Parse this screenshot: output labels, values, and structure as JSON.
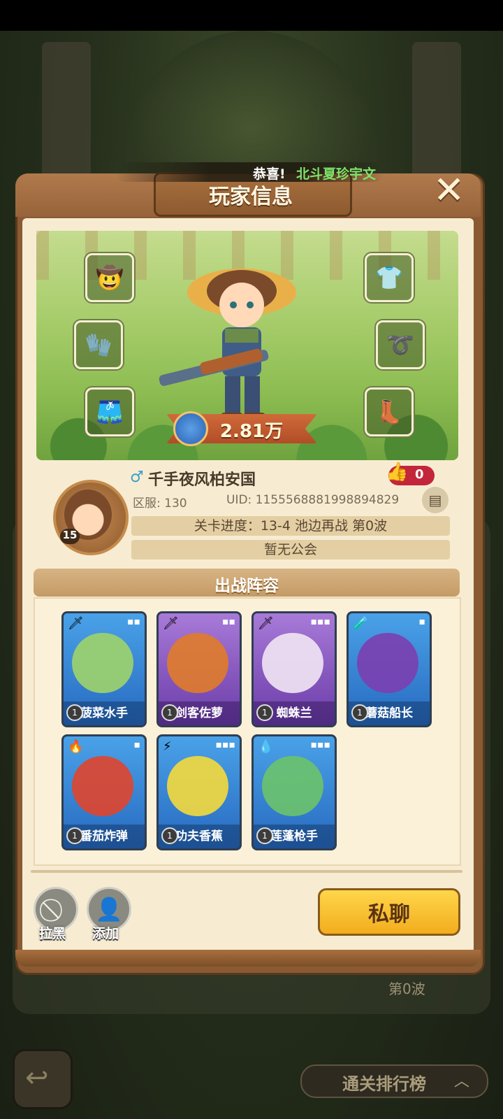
{
  "background": {
    "rank_button_label": "通关排行榜",
    "wave_text": "第0波"
  },
  "dialog": {
    "title": "玩家信息",
    "congrats_label": "恭喜!",
    "congrats_name": "北斗夏珍宇文"
  },
  "equipment_slots": [
    {
      "name": "hat-slot",
      "icon": "hat-icon",
      "glyph": "🤠"
    },
    {
      "name": "glove-slot",
      "icon": "glove-icon",
      "glyph": "🧤"
    },
    {
      "name": "pants-slot",
      "icon": "pants-icon",
      "glyph": "🩳"
    },
    {
      "name": "shirt-slot",
      "icon": "shirt-icon",
      "glyph": "👕"
    },
    {
      "name": "belt-slot",
      "icon": "belt-icon",
      "glyph": "➰"
    },
    {
      "name": "boots-slot",
      "icon": "boots-icon",
      "glyph": "👢"
    }
  ],
  "power": "2.81万",
  "player": {
    "name": "千手夜风柏安国",
    "level": "15",
    "likes": "0",
    "server": "区服: 130",
    "uid": "UID: 1155568881998894829",
    "stage_progress": "关卡进度：13-4  池边再战 第0波",
    "guild": "暂无公会"
  },
  "lineup": {
    "title": "出战阵容",
    "cards": [
      {
        "name": "菠菜水手",
        "level": "1",
        "theme": "blue",
        "element": "🗡",
        "shape": "▪▪",
        "art_color": "#9fd36a"
      },
      {
        "name": "剑客佐萝",
        "level": "1",
        "theme": "purple",
        "element": "🗡",
        "shape": "▪▪",
        "art_color": "#e07b2a"
      },
      {
        "name": "蜘蛛兰",
        "level": "1",
        "theme": "purple",
        "element": "🗡",
        "shape": "▪▪▪",
        "art_color": "#f2e6f4"
      },
      {
        "name": "蘑菇船长",
        "level": "1",
        "theme": "blue",
        "element": "🧪",
        "shape": "▪",
        "art_color": "#7b3fb0"
      },
      {
        "name": "番茄炸弹",
        "level": "1",
        "theme": "blue",
        "element": "🔥",
        "shape": "▪",
        "art_color": "#e0452c"
      },
      {
        "name": "功夫香蕉",
        "level": "1",
        "theme": "blue",
        "element": "⚡",
        "shape": "▪▪▪",
        "art_color": "#f4d93c"
      },
      {
        "name": "莲蓬枪手",
        "level": "1",
        "theme": "blue",
        "element": "💧",
        "shape": "▪▪▪",
        "art_color": "#6cc36a"
      }
    ]
  },
  "actions": {
    "block_label": "拉黑",
    "add_label": "添加",
    "chat_label": "私聊"
  },
  "colors": {
    "dialog_brown": "#8a5a33",
    "parchment": "#f7ecd2",
    "chat_button": "#f2ad1e",
    "congrats_name": "#7ee36a"
  }
}
